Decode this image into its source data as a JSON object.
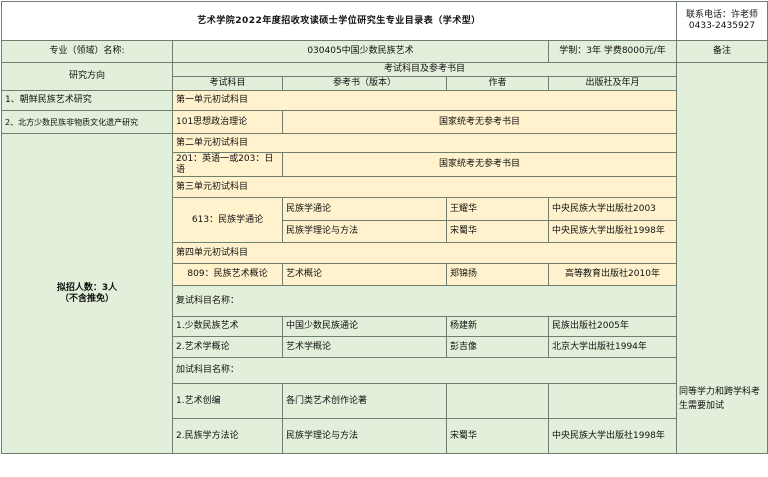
{
  "header": {
    "title": "艺术学院2022年度招收攻读硕士学位研究生专业目录表（学术型）",
    "contact_label": "联系电话：许老师",
    "contact_phone": "0433-2435927"
  },
  "major_row": {
    "label": "专业（领域）名称:",
    "value": "030405中国少数民族艺术",
    "duration_fee": "学制：3年  学费8000元/年",
    "remarks_label": "备注"
  },
  "columns": {
    "direction": "研究方向",
    "exam_group": "考试科目及参考书目",
    "subject": "考试科目",
    "book": "参考书（版本）",
    "author": "作者",
    "publisher": "出版社及年月"
  },
  "directions": [
    "1、朝鲜民族艺术研究",
    "2、北方少数民族非物质文化遗产研究"
  ],
  "enrollment": {
    "line1": "拟招人数：3人",
    "line2": "（不含推免）"
  },
  "units": {
    "u1": {
      "title": "第一单元初试科目",
      "subject": "101思想政治理论",
      "note": "国家统考无参考书目"
    },
    "u2": {
      "title": "第二单元初试科目",
      "subject": "201：英语一或203：日语",
      "note": "国家统考无参考书目"
    },
    "u3": {
      "title": "第三单元初试科目",
      "subject": "613：民族学通论",
      "books": [
        {
          "book": "民族学通论",
          "author": "王耀华",
          "publisher": "中央民族大学出版社2003"
        },
        {
          "book": "民族学理论与方法",
          "author": "宋蜀华",
          "publisher": "中央民族大学出版社1998年"
        }
      ]
    },
    "u4": {
      "title": "第四单元初试科目",
      "subject": "809：民族艺术概论",
      "book": "艺术概论",
      "author": "郑锦扬",
      "publisher": "高等教育出版社2010年"
    }
  },
  "retest": {
    "title": "复试科目名称：",
    "rows": [
      {
        "subject": "1.少数民族艺术",
        "book": "中国少数民族通论",
        "author": "杨建新",
        "publisher": "民族出版社2005年"
      },
      {
        "subject": "2.艺术学概论",
        "book": "艺术学概论",
        "author": "彭吉像",
        "publisher": "北京大学出版社1994年"
      }
    ]
  },
  "additional": {
    "title": "加试科目名称：",
    "rows": [
      {
        "subject": "1.艺术创编",
        "book": "各门类艺术创作论著",
        "author": "",
        "publisher": ""
      },
      {
        "subject": "2.民族学方法论",
        "book": "民族学理论与方法",
        "author": "宋蜀华",
        "publisher": "中央民族大学出版社1998年"
      }
    ],
    "remark": "同等学力和跨学科考生需要加试"
  }
}
